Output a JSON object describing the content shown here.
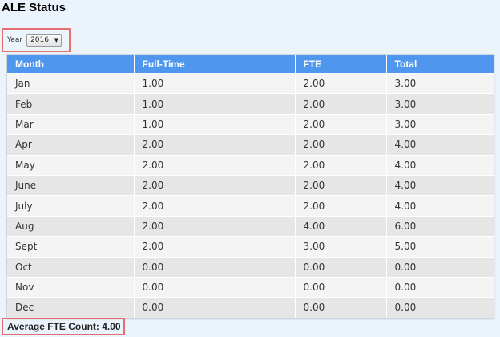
{
  "page": {
    "title": "ALE Status"
  },
  "year_filter": {
    "label": "Year",
    "selected": "2016"
  },
  "table": {
    "columns": [
      "Month",
      "Full-Time",
      "FTE",
      "Total"
    ],
    "rows": [
      [
        "Jan",
        "1.00",
        "2.00",
        "3.00"
      ],
      [
        "Feb",
        "1.00",
        "2.00",
        "3.00"
      ],
      [
        "Mar",
        "1.00",
        "2.00",
        "3.00"
      ],
      [
        "Apr",
        "2.00",
        "2.00",
        "4.00"
      ],
      [
        "May",
        "2.00",
        "2.00",
        "4.00"
      ],
      [
        "June",
        "2.00",
        "2.00",
        "4.00"
      ],
      [
        "July",
        "2.00",
        "2.00",
        "4.00"
      ],
      [
        "Aug",
        "2.00",
        "4.00",
        "6.00"
      ],
      [
        "Sept",
        "2.00",
        "3.00",
        "5.00"
      ],
      [
        "Oct",
        "0.00",
        "0.00",
        "0.00"
      ],
      [
        "Nov",
        "0.00",
        "0.00",
        "0.00"
      ],
      [
        "Dec",
        "0.00",
        "0.00",
        "0.00"
      ]
    ]
  },
  "summary": {
    "average_fte": "Average FTE Count: 4.00"
  },
  "colors": {
    "header_bg": "#4f97ee",
    "highlight_border": "#e46f6f",
    "page_bg": "#ebf3fc"
  }
}
